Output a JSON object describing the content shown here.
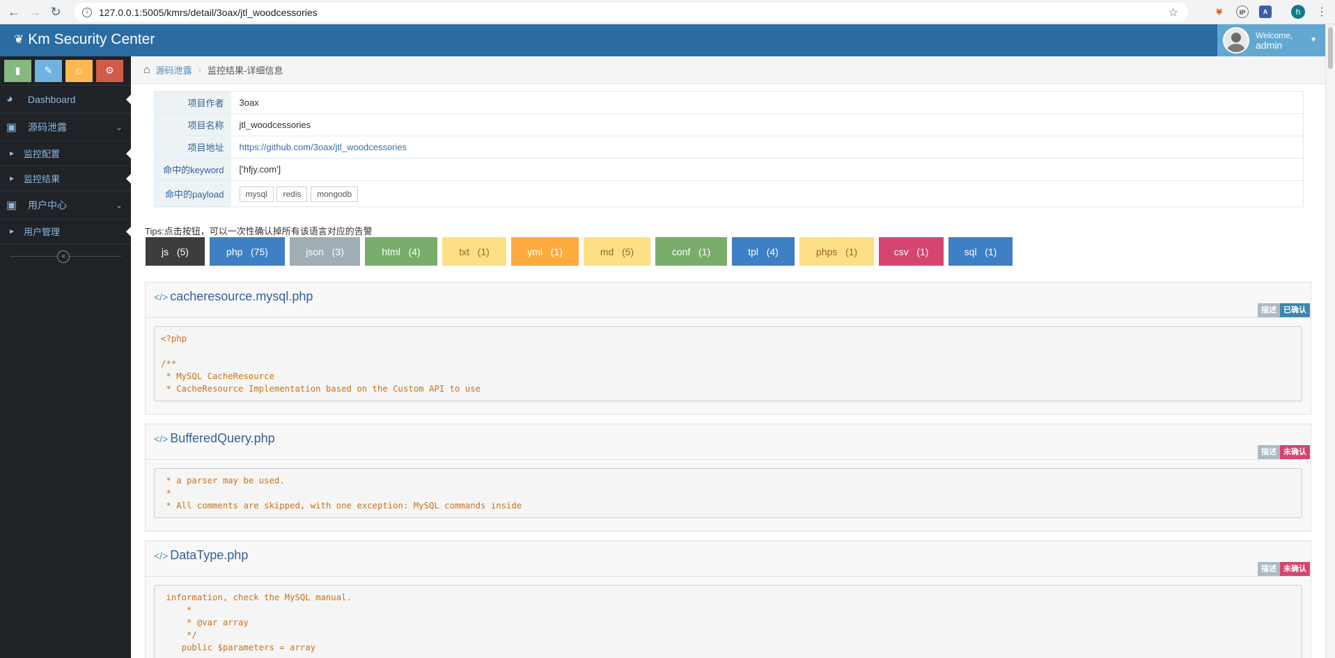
{
  "browser": {
    "url": "127.0.0.1:5005/kmrs/detail/3oax/jtl_woodcessories",
    "profile_initial": "h",
    "ext1": "🦊",
    "ext2": "IP",
    "ext3": "A"
  },
  "header": {
    "brand": "Km Security Center",
    "welcome": "Welcome,",
    "username": "admin"
  },
  "sidebar": {
    "dashboard": "Dashboard",
    "source_leak": "源码泄露",
    "monitor_config": "监控配置",
    "monitor_result": "监控结果",
    "user_center": "用户中心",
    "user_manage": "用户管理"
  },
  "breadcrumb": {
    "parent": "源码泄露",
    "current": "监控结果-详细信息"
  },
  "details": {
    "author_label": "项目作者",
    "author": "3oax",
    "name_label": "项目名称",
    "name": "jtl_woodcessories",
    "url_label": "项目地址",
    "url": "https://github.com/3oax/jtl_woodcessories",
    "keyword_label": "命中的keyword",
    "keyword": "['hfjy.com']",
    "payload_label": "命中的payload",
    "payloads": [
      "mysql",
      "redis",
      "mongodb"
    ]
  },
  "tips": "Tips:点击按钮，可以一次性确认掉所有该语言对应的告警",
  "languages": [
    {
      "label": "js   (5)",
      "color": "#3d3d3d",
      "text": "#ffffff"
    },
    {
      "label": "php   (75)",
      "color": "#3f7fc4",
      "text": "#ffffff"
    },
    {
      "label": "json   (3)",
      "color": "#a0adb5",
      "text": "#ffffff"
    },
    {
      "label": "html   (4)",
      "color": "#7aad6b",
      "text": "#ffffff"
    },
    {
      "label": "txt   (1)",
      "color": "#fddf86",
      "text": "#996633"
    },
    {
      "label": "yml   (1)",
      "color": "#ffab40",
      "text": "#ffffff"
    },
    {
      "label": "md   (5)",
      "color": "#fddf86",
      "text": "#996633"
    },
    {
      "label": "conf   (1)",
      "color": "#7aad6b",
      "text": "#ffffff"
    },
    {
      "label": "tpl   (4)",
      "color": "#3f7fc4",
      "text": "#ffffff"
    },
    {
      "label": "phps   (1)",
      "color": "#fddf86",
      "text": "#996633"
    },
    {
      "label": "csv   (1)",
      "color": "#d4456f",
      "text": "#ffffff"
    },
    {
      "label": "sql   (1)",
      "color": "#3f7fc4",
      "text": "#ffffff"
    }
  ],
  "results": [
    {
      "file": "cacheresource.mysql.php",
      "desc_label": "描述",
      "status": "已确认",
      "status_color": "#3a87ad",
      "code": "<?php\n\n/**\n * MySQL CacheResource\n * CacheResource Implementation based on the Custom API to use"
    },
    {
      "file": "BufferedQuery.php",
      "desc_label": "描述",
      "status": "未确认",
      "status_color": "#d4456f",
      "code": " * a parser may be used.\n *\n * All comments are skipped, with one exception: MySQL commands inside"
    },
    {
      "file": "DataType.php",
      "desc_label": "描述",
      "status": "未确认",
      "status_color": "#d4456f",
      "code": " information, check the MySQL manual.\n     *\n     * @var array\n     */\n    public $parameters = array"
    }
  ]
}
